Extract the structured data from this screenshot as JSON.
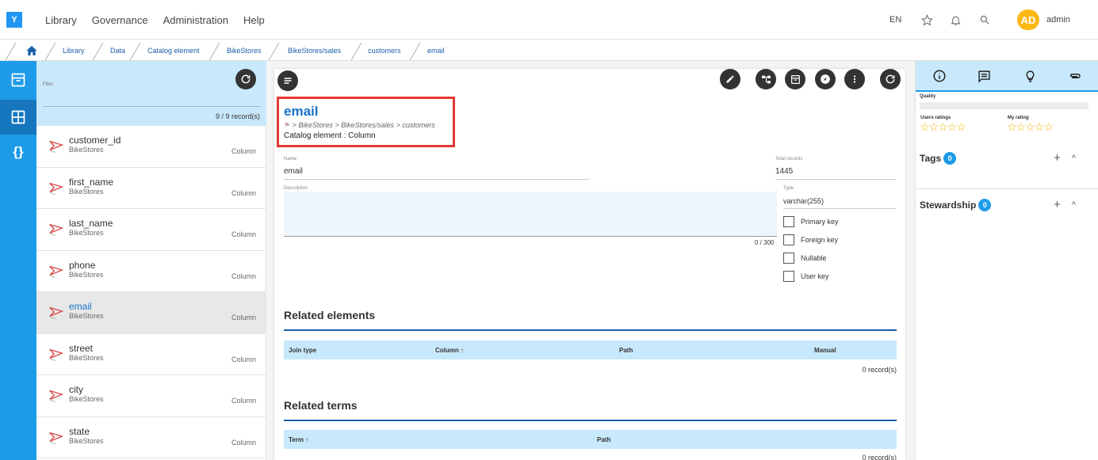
{
  "app": {
    "logo_letter": "Y",
    "menu": [
      "Library",
      "Governance",
      "Administration",
      "Help"
    ],
    "language": "EN",
    "avatar_initials": "AD",
    "username": "admin"
  },
  "breadcrumb": [
    "Library",
    "Data",
    "Catalog element",
    "BikeStores",
    "BikeStores/sales",
    "customers",
    "email"
  ],
  "list": {
    "filter_label": "Filter",
    "record_count": "9 / 9 record(s)",
    "items": [
      {
        "name": "customer_id",
        "source": "BikeStores",
        "type": "Column"
      },
      {
        "name": "first_name",
        "source": "BikeStores",
        "type": "Column"
      },
      {
        "name": "last_name",
        "source": "BikeStores",
        "type": "Column"
      },
      {
        "name": "phone",
        "source": "BikeStores",
        "type": "Column"
      },
      {
        "name": "email",
        "source": "BikeStores",
        "type": "Column",
        "active": true
      },
      {
        "name": "street",
        "source": "BikeStores",
        "type": "Column"
      },
      {
        "name": "city",
        "source": "BikeStores",
        "type": "Column"
      },
      {
        "name": "state",
        "source": "BikeStores",
        "type": "Column"
      }
    ]
  },
  "detail": {
    "title": "email",
    "path": "> BikeStores > BikeStores/sales > customers",
    "subtitle": "Catalog element : Column",
    "name_label": "Name",
    "name_value": "email",
    "total_records_label": "Total records",
    "total_records_value": "1445",
    "description_label": "Description",
    "description_counter": "0 / 300",
    "type_label": "Type",
    "type_value": "varchar(255)",
    "checkboxes": [
      "Primary key",
      "Foreign key",
      "Nullable",
      "User key"
    ],
    "related_elements": {
      "title": "Related elements",
      "columns": [
        "Join type",
        "Column ↑",
        "Path",
        "Manual"
      ],
      "records": "0 record(s)"
    },
    "related_terms": {
      "title": "Related terms",
      "columns": [
        "Term ↑",
        "Path"
      ],
      "records": "0 record(s)"
    }
  },
  "right_panel": {
    "quality_label": "Quality",
    "users_ratings_label": "Users ratings",
    "my_rating_label": "My rating",
    "stars": "☆☆☆☆☆",
    "tags_label": "Tags",
    "tags_count": "0",
    "stewardship_label": "Stewardship",
    "stewardship_count": "0"
  },
  "colors": {
    "accent": "#1e9be8",
    "header_bg": "#c8e8fb",
    "highlight_box": "#e53935",
    "avatar": "#fbb814"
  }
}
